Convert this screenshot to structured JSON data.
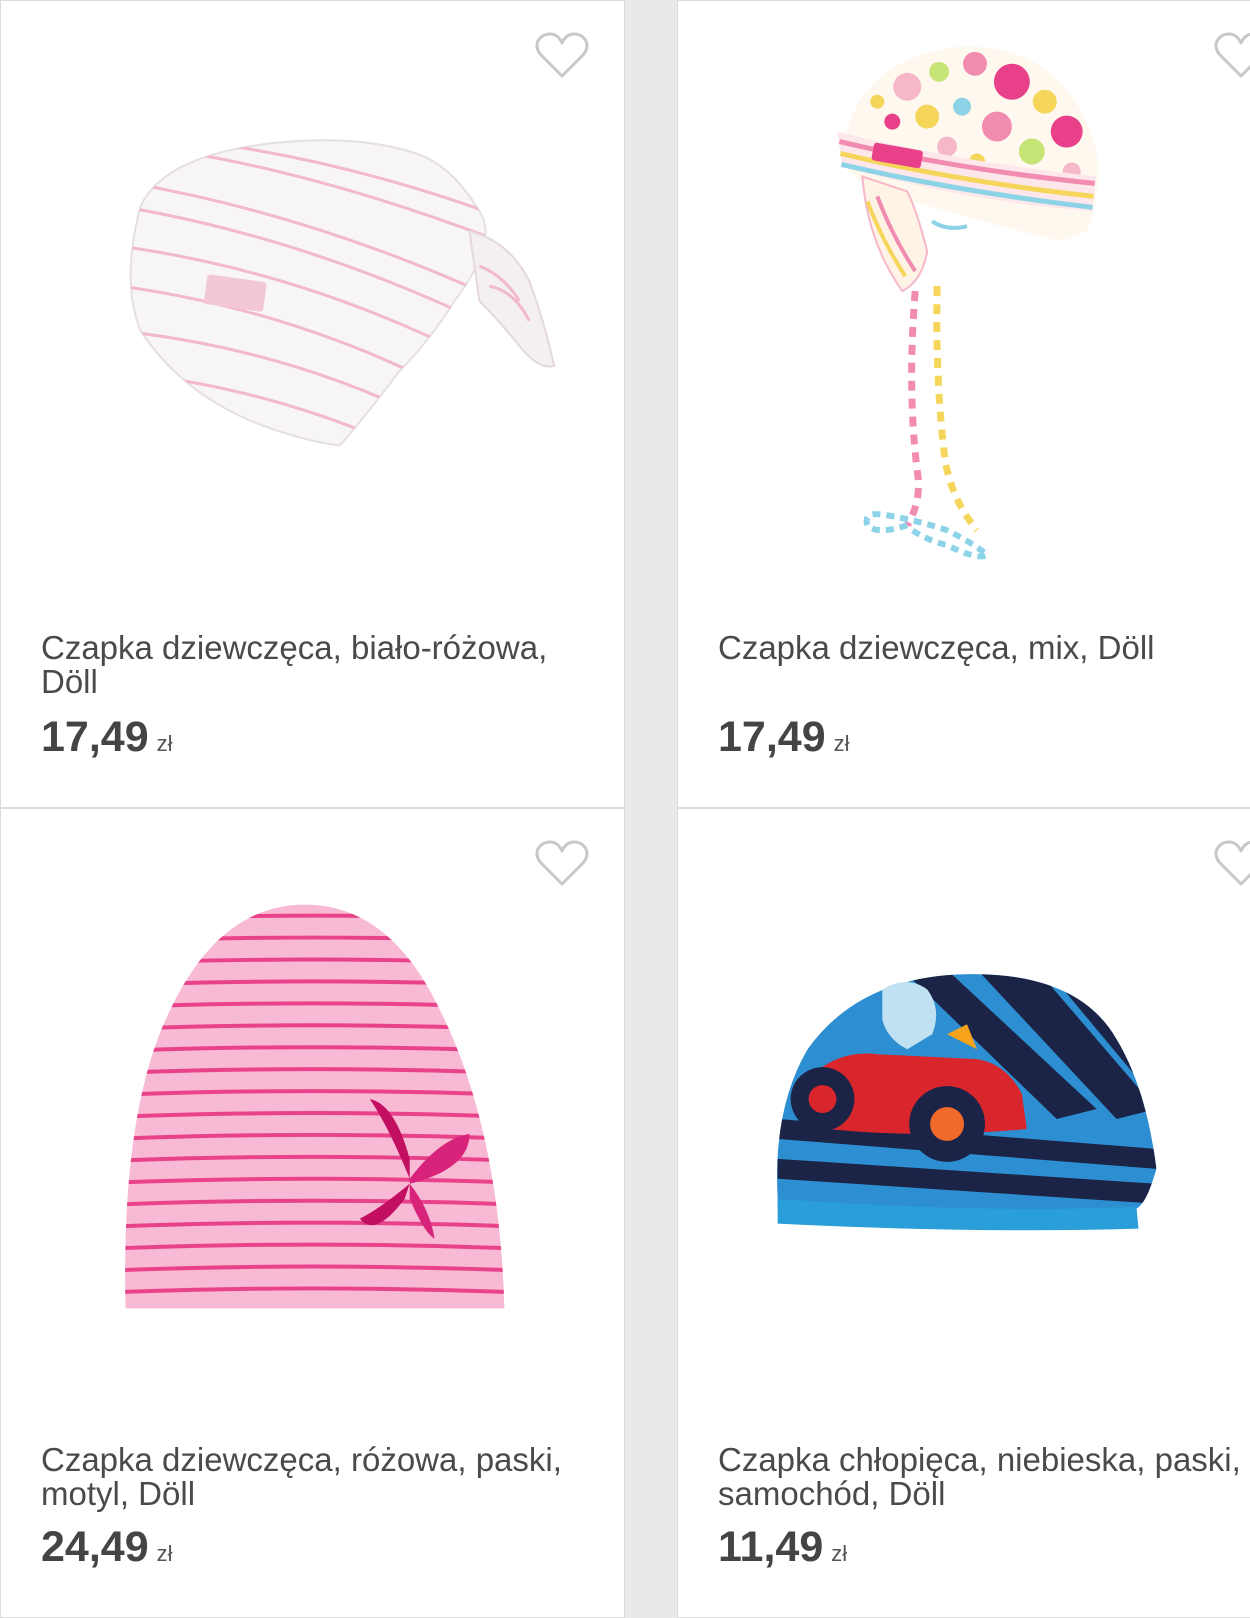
{
  "products": [
    {
      "title": "Czapka dziewczęca, biało-różowa, Döll",
      "price": "17,49",
      "currency": "zł",
      "image": "white-pink-striped-knotted-hat"
    },
    {
      "title": "Czapka dziewczęca, mix, Döll",
      "price": "17,49",
      "currency": "zł",
      "image": "colorful-dotted-hat-with-ties"
    },
    {
      "title": "Czapka dziewczęca, różowa, paski, motyl, Döll",
      "price": "24,49",
      "currency": "zł",
      "image": "pink-striped-beanie-butterfly"
    },
    {
      "title": "Czapka chłopięca, niebieska, paski, samochód, Döll",
      "price": "11,49",
      "currency": "zł",
      "image": "blue-striped-hat-racing-car"
    }
  ],
  "icons": {
    "favorite": "heart-outline-icon"
  },
  "colors": {
    "background": "#e9e9e9",
    "card": "#ffffff",
    "heart": "#c8c8c8"
  }
}
